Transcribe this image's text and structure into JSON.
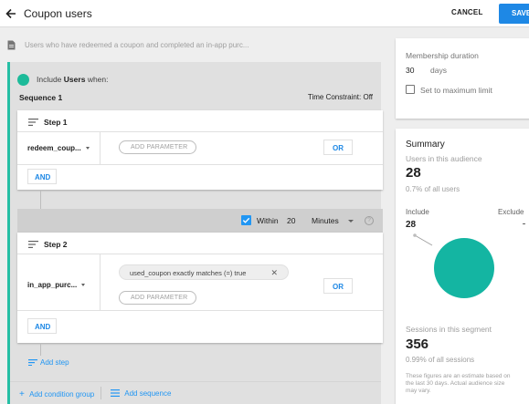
{
  "header": {
    "title": "Coupon users",
    "cancel_label": "CANCEL",
    "save_label": "SAVE"
  },
  "description": "Users who have redeemed a coupon and completed an in-app purc...",
  "condition": {
    "include_prefix": "Include",
    "include_subject": "Users",
    "include_suffix": "when:",
    "sequence_title": "Sequence 1",
    "time_constraint": "Time Constraint: Off"
  },
  "steps": [
    {
      "title": "Step 1",
      "event": "redeem_coup...",
      "add_parameter": "ADD PARAMETER",
      "or_label": "OR",
      "and_label": "AND"
    },
    {
      "title": "Step 2",
      "event": "in_app_purc...",
      "filter_chip": "used_coupon exactly matches (=) true",
      "add_parameter": "ADD PARAMETER",
      "or_label": "OR",
      "and_label": "AND"
    }
  ],
  "within": {
    "checked": true,
    "label": "Within",
    "value": "20",
    "unit": "Minutes"
  },
  "actions": {
    "add_step": "Add step",
    "add_condition_group": "Add condition group",
    "add_sequence": "Add sequence"
  },
  "membership": {
    "label": "Membership duration",
    "value": "30",
    "unit": "days",
    "max_label": "Set to maximum limit"
  },
  "summary": {
    "title": "Summary",
    "users_label": "Users in this audience",
    "users_count": "28",
    "users_pct": "0.7% of all users",
    "include_label": "Include",
    "include_value": "28",
    "exclude_label": "Exclude",
    "sessions_label": "Sessions in this segment",
    "sessions_count": "356",
    "sessions_pct": "0.99% of all sessions",
    "note_1": "These figures are an estimate based on",
    "note_2": "the last 30 days. Actual audience size",
    "note_3": "may vary.",
    "pie_color": "#14b5a2"
  },
  "colors": {
    "accent": "#1e88e5",
    "teal": "#26bfa5"
  }
}
